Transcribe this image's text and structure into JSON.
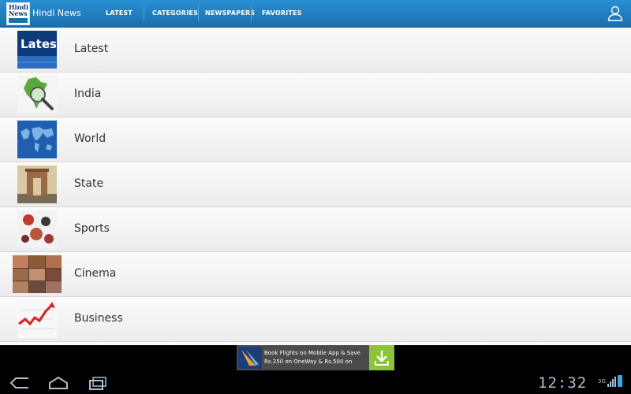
{
  "app": {
    "title": "Hindi News",
    "icon_text": "Hindi News"
  },
  "tabs": [
    {
      "label": "LATEST"
    },
    {
      "label": "CATEGORIES"
    },
    {
      "label": "NEWSPAPERS"
    },
    {
      "label": "FAVORITES"
    }
  ],
  "categories": [
    {
      "label": "Latest",
      "thumb_text": "Latest news"
    },
    {
      "label": "India"
    },
    {
      "label": "World"
    },
    {
      "label": "State"
    },
    {
      "label": "Sports"
    },
    {
      "label": "Cinema"
    },
    {
      "label": "Business"
    }
  ],
  "ad": {
    "line1": "Book Flights on Mobile App & Save",
    "line2": "Rs.250 on OneWay & Rs.500 on"
  },
  "system": {
    "clock": "12:32",
    "network": "3G"
  },
  "colors": {
    "actionbar": "#1a6fb0",
    "ad_button": "#8bc33a",
    "text": "#333333"
  }
}
